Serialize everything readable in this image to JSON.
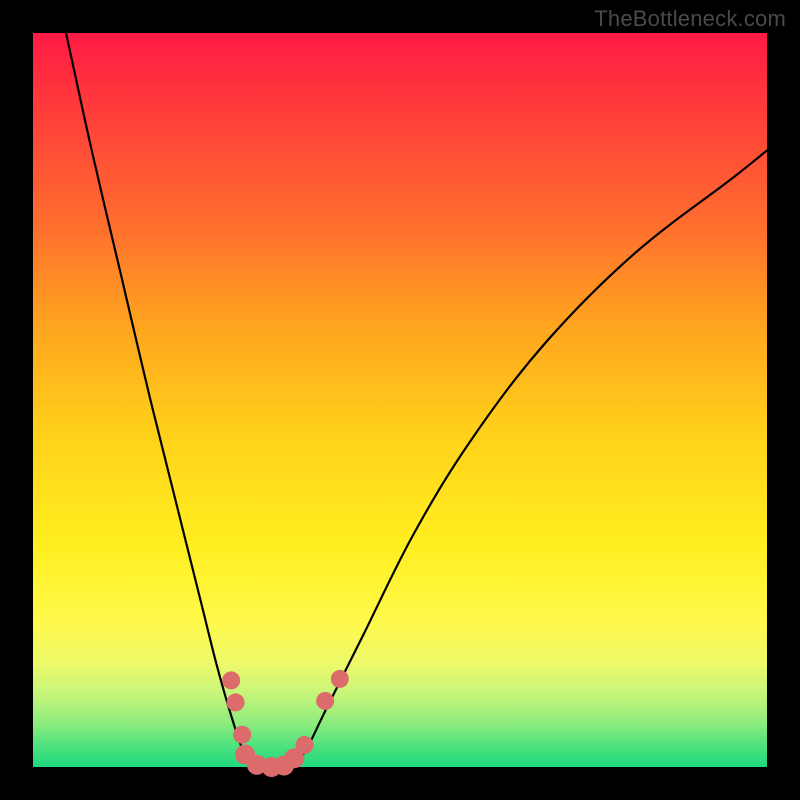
{
  "watermark": "TheBottleneck.com",
  "chart_data": {
    "type": "line",
    "title": "",
    "xlabel": "",
    "ylabel": "",
    "xlim": [
      0,
      100
    ],
    "ylim": [
      0,
      100
    ],
    "grid": false,
    "legend": false,
    "background_gradient": {
      "top": "#ff1a44",
      "mid": "#ffef20",
      "bottom": "#1fd97f"
    },
    "series": [
      {
        "name": "left-curve",
        "color": "#000000",
        "x": [
          4.5,
          8,
          12,
          16,
          20,
          23,
          25,
          27,
          28.7,
          30
        ],
        "y": [
          100,
          84,
          67,
          50,
          34,
          22,
          14,
          7,
          2,
          0
        ]
      },
      {
        "name": "right-curve",
        "color": "#000000",
        "x": [
          35,
          37,
          40,
          45,
          52,
          60,
          70,
          82,
          95,
          100
        ],
        "y": [
          0,
          2,
          8,
          18,
          32,
          45,
          58,
          70,
          80,
          84
        ]
      },
      {
        "name": "valley-floor",
        "color": "#000000",
        "x": [
          30,
          32.5,
          35
        ],
        "y": [
          0,
          0,
          0
        ]
      }
    ],
    "markers": [
      {
        "name": "left-dot-1",
        "x": 27.0,
        "y": 11.8,
        "color": "#dc6b6b",
        "r": 9
      },
      {
        "name": "left-dot-2",
        "x": 27.6,
        "y": 8.8,
        "color": "#dc6b6b",
        "r": 9
      },
      {
        "name": "left-dot-3",
        "x": 28.5,
        "y": 4.4,
        "color": "#dc6b6b",
        "r": 9
      },
      {
        "name": "left-dot-4",
        "x": 28.9,
        "y": 1.7,
        "color": "#dc6b6b",
        "r": 10
      },
      {
        "name": "floor-dot-1",
        "x": 30.5,
        "y": 0.3,
        "color": "#dc6b6b",
        "r": 10
      },
      {
        "name": "floor-dot-2",
        "x": 32.5,
        "y": 0.0,
        "color": "#dc6b6b",
        "r": 10
      },
      {
        "name": "floor-dot-3",
        "x": 34.2,
        "y": 0.2,
        "color": "#dc6b6b",
        "r": 10
      },
      {
        "name": "right-dot-1",
        "x": 35.6,
        "y": 1.2,
        "color": "#dc6b6b",
        "r": 10
      },
      {
        "name": "right-dot-2",
        "x": 37.0,
        "y": 3.0,
        "color": "#dc6b6b",
        "r": 9
      },
      {
        "name": "right-dot-3",
        "x": 39.8,
        "y": 9.0,
        "color": "#dc6b6b",
        "r": 9
      },
      {
        "name": "right-dot-4",
        "x": 41.8,
        "y": 12.0,
        "color": "#dc6b6b",
        "r": 9
      }
    ]
  }
}
